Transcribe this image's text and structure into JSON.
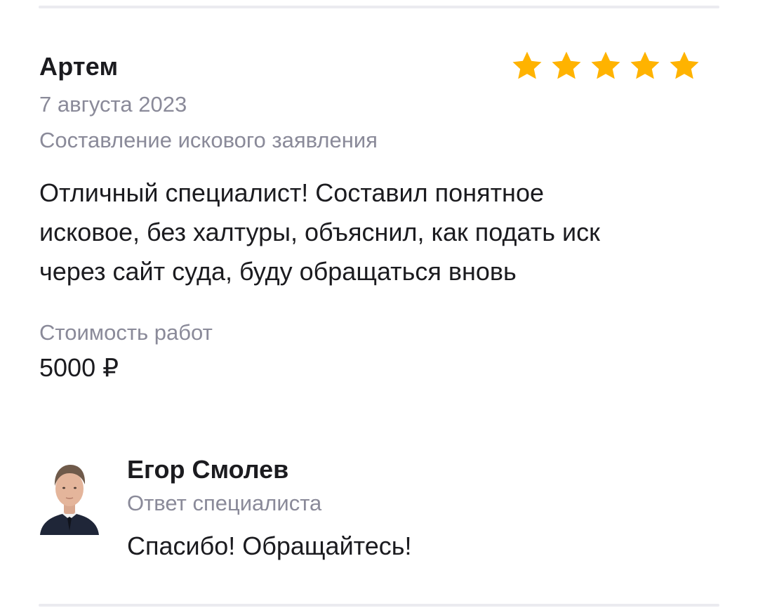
{
  "review": {
    "author": "Артем",
    "rating": 5,
    "rating_max": 5,
    "star_color": "#ffb300",
    "date": "7 августа 2023",
    "service": "Составление искового заявления",
    "text": "Отличный специалист! Составил понятное\nисковое, без халтуры, объяснил, как подать иск\nчерез сайт суда, буду обращаться вновь",
    "cost_label": "Стоимость работ",
    "cost_value": "5000 ₽"
  },
  "reply": {
    "avatar_icon": "specialist-photo",
    "name": "Егор Смолев",
    "role": "Ответ специалиста",
    "text": "Спасибо! Обращайтесь!"
  }
}
